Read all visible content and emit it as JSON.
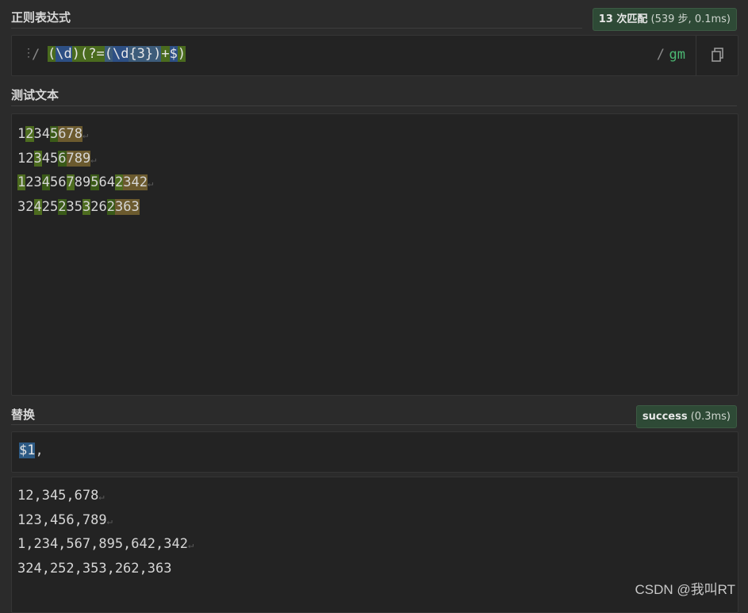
{
  "regex_section": {
    "title": "正则表达式",
    "match_count": "13 次匹配",
    "match_meta": "(539 步, 0.1ms)",
    "open_slash": "/",
    "close_slash": "/",
    "flags": "gm",
    "pattern_tokens": [
      "(",
      "\\d",
      ")",
      "(?=",
      "(",
      "\\d",
      "{3}",
      ")",
      "+",
      "$",
      ")"
    ]
  },
  "test_section": {
    "title": "测试文本",
    "lines": [
      {
        "segments": [
          [
            "1",
            ""
          ],
          [
            "2",
            "a"
          ],
          [
            "3",
            ""
          ],
          [
            "4",
            ""
          ],
          [
            "5",
            "b"
          ],
          [
            "678",
            "la"
          ]
        ],
        "eol": "↵"
      },
      {
        "segments": [
          [
            "1",
            ""
          ],
          [
            "2",
            ""
          ],
          [
            "3",
            "a"
          ],
          [
            "4",
            ""
          ],
          [
            "5",
            ""
          ],
          [
            "6",
            "b"
          ],
          [
            "789",
            "la"
          ]
        ],
        "eol": "↵"
      },
      {
        "segments": [
          [
            "1",
            "a"
          ],
          [
            "2",
            ""
          ],
          [
            "3",
            ""
          ],
          [
            "4",
            "b"
          ],
          [
            "5",
            ""
          ],
          [
            "6",
            ""
          ],
          [
            "7",
            "a"
          ],
          [
            "8",
            ""
          ],
          [
            "9",
            ""
          ],
          [
            "5",
            "b"
          ],
          [
            "6",
            ""
          ],
          [
            "4",
            ""
          ],
          [
            "2",
            "a"
          ],
          [
            "342",
            "la"
          ]
        ],
        "eol": "↵"
      },
      {
        "segments": [
          [
            "3",
            ""
          ],
          [
            "2",
            ""
          ],
          [
            "4",
            "a"
          ],
          [
            "2",
            ""
          ],
          [
            "5",
            ""
          ],
          [
            "2",
            "b"
          ],
          [
            "3",
            ""
          ],
          [
            "5",
            ""
          ],
          [
            "3",
            "a"
          ],
          [
            "2",
            ""
          ],
          [
            "6",
            ""
          ],
          [
            "2",
            "b"
          ],
          [
            "363",
            "la"
          ]
        ],
        "eol": ""
      }
    ]
  },
  "replace_section": {
    "title": "替换",
    "status": "success",
    "status_meta": "(0.3ms)",
    "replacement_token": "$1",
    "replacement_rest": ",",
    "results": [
      "12,345,678",
      "123,456,789",
      "1,234,567,895,642,342",
      "324,252,353,262,363"
    ],
    "result_eols": [
      "↵",
      "↵",
      "↵",
      ""
    ]
  },
  "watermark": "CSDN @我叫RT",
  "icons": {
    "drag": "drag-handle-icon",
    "copy": "copy-icon"
  },
  "colors": {
    "bg": "#2b2b2b",
    "panel": "#232323",
    "group": "#4a6b1e",
    "escape": "#2d4f84",
    "lookahead_match": "#6b5a2e",
    "flags": "#4cb873",
    "badge": "#2e4a36"
  }
}
